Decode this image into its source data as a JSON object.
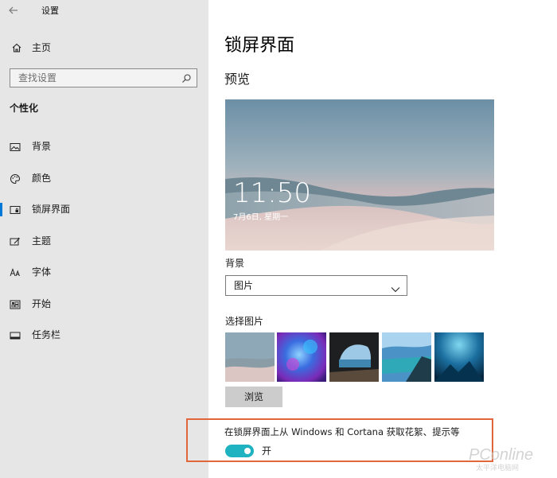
{
  "window": {
    "back_icon": "back-arrow-icon",
    "title": "设置"
  },
  "sidebar": {
    "home": {
      "icon": "home-icon",
      "label": "主页"
    },
    "search": {
      "placeholder": "查找设置",
      "icon": "search-icon"
    },
    "section_title": "个性化",
    "items": [
      {
        "label": "背景",
        "icon": "picture-icon",
        "active": false
      },
      {
        "label": "颜色",
        "icon": "palette-icon",
        "active": false
      },
      {
        "label": "锁屏界面",
        "icon": "lock-screen-icon",
        "active": true
      },
      {
        "label": "主题",
        "icon": "theme-icon",
        "active": false
      },
      {
        "label": "字体",
        "icon": "font-icon",
        "active": false
      },
      {
        "label": "开始",
        "icon": "start-icon",
        "active": false
      },
      {
        "label": "任务栏",
        "icon": "taskbar-icon",
        "active": false
      }
    ],
    "accent_color": "#0078d7"
  },
  "main": {
    "title": "锁屏界面",
    "preview_heading": "预览",
    "preview": {
      "time": "11:50",
      "date": "7月6日, 星期一"
    },
    "background_label": "背景",
    "background_select": {
      "value": "图片"
    },
    "choose_picture_label": "选择图片",
    "thumbnails": [
      "desert-dunes",
      "blue-purple-abstract",
      "cave-sea-view",
      "beach-aerial",
      "underwater-light"
    ],
    "browse_label": "浏览",
    "spotlight_text": "在锁屏界面上从 Windows 和 Cortana 获取花絮、提示等",
    "toggle": {
      "state": "开",
      "on": true,
      "color": "#1fb3c2"
    }
  },
  "watermark": {
    "text": "PConline",
    "sub": "太平洋电脑网"
  }
}
